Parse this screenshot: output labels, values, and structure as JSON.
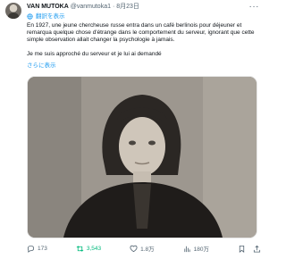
{
  "author": {
    "name": "VAN MUTOKA",
    "handle": "@vanmutoka1",
    "separator": "·",
    "date": "8月23日"
  },
  "translate_label": "翻訳を表示",
  "tweet": {
    "paragraph1": "En 1927, une jeune chercheuse russe entra dans un café berlinois pour déjeuner et remarqua quelque chose d'étrange dans le comportement du serveur, ignorant que cette simple observation allait changer la psychologie à jamais.",
    "paragraph2": "Je me suis approché du serveur et je lui ai demandé",
    "show_more": "さらに表示"
  },
  "media": {
    "alt": "photo"
  },
  "actions": {
    "replies": "173",
    "retweets": "3,543",
    "likes": "1.8万",
    "views": "180万"
  },
  "colors": {
    "accent": "#1d9bf0",
    "retweet": "#00ba7c",
    "muted": "#536471"
  },
  "icons": [
    "more-icon",
    "globe-icon",
    "reply-icon",
    "retweet-icon",
    "like-icon",
    "views-icon",
    "bookmark-icon",
    "share-icon"
  ]
}
